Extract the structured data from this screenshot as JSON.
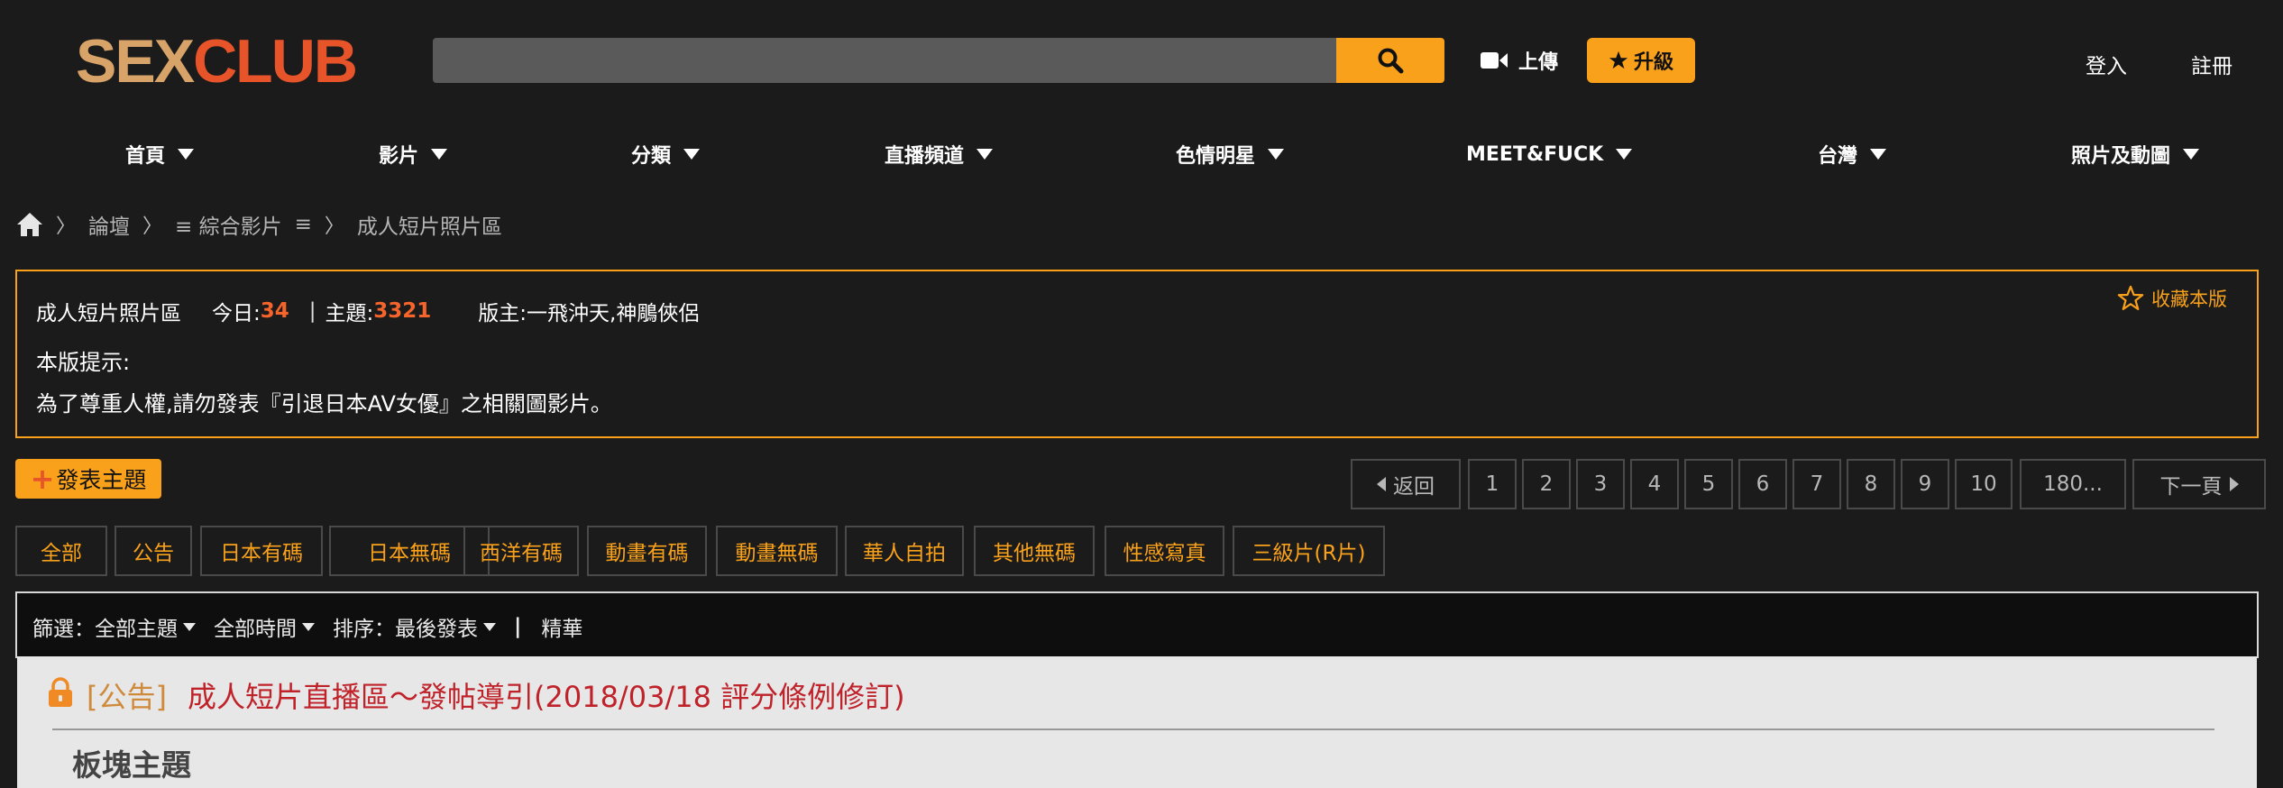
{
  "header": {
    "logo_part1": "SEX",
    "logo_part2": "CLUB",
    "search_placeholder": "",
    "upload_label": "上傳",
    "upgrade_label": "升級",
    "login_label": "登入",
    "register_label": "註冊"
  },
  "nav": [
    {
      "label": "首頁"
    },
    {
      "label": "影片"
    },
    {
      "label": "分類"
    },
    {
      "label": "直播頻道"
    },
    {
      "label": "色情明星"
    },
    {
      "label": "MEET&FUCK"
    },
    {
      "label": "台灣"
    },
    {
      "label": "照片及動圖"
    }
  ],
  "breadcrumb": {
    "forum": "論壇",
    "category": "≡ 綜合影片",
    "menu": "≡",
    "current": "成人短片照片區"
  },
  "forum_info": {
    "name": "成人短片照片區",
    "today_label": "今日:",
    "today_count": "34",
    "separator": "|",
    "topics_label": "主題:",
    "topics_count": "3321",
    "moderators": "版主:一飛沖天,神鵰俠侶",
    "favorite_label": "收藏本版",
    "tip_title": "本版提示:",
    "tip_text": "為了尊重人權,請勿發表『引退日本AV女優』之相關圖影片。"
  },
  "post_button": "發表主題",
  "pagination": {
    "back": "返回",
    "pages": [
      "1",
      "2",
      "3",
      "4",
      "5",
      "6",
      "7",
      "8",
      "9",
      "10",
      "180..."
    ],
    "next": "下一頁"
  },
  "categories": [
    "全部",
    "公告",
    "日本有碼",
    "日本無碼",
    "西洋有碼",
    "動畫有碼",
    "動畫無碼",
    "華人自拍",
    "其他無碼",
    "性感寫真",
    "三級片(R片)"
  ],
  "filters": {
    "filter_prefix": "篩選：",
    "topic_filter": "全部主題",
    "time_filter": "全部時間",
    "sort": "排序：最後發表",
    "separator": "|",
    "digest": "精華"
  },
  "threads": {
    "announcement_tag": "[公告]",
    "announcement_title": "成人短片直播區～發帖導引(2018/03/18  評分條例修訂)",
    "section_title": "板塊主題"
  },
  "colors": {
    "accent": "#f9a11b",
    "logo_tan": "#d8a368",
    "logo_orange": "#e8542a",
    "count_orange": "#f5642a",
    "announcement_red": "#c0222a"
  }
}
